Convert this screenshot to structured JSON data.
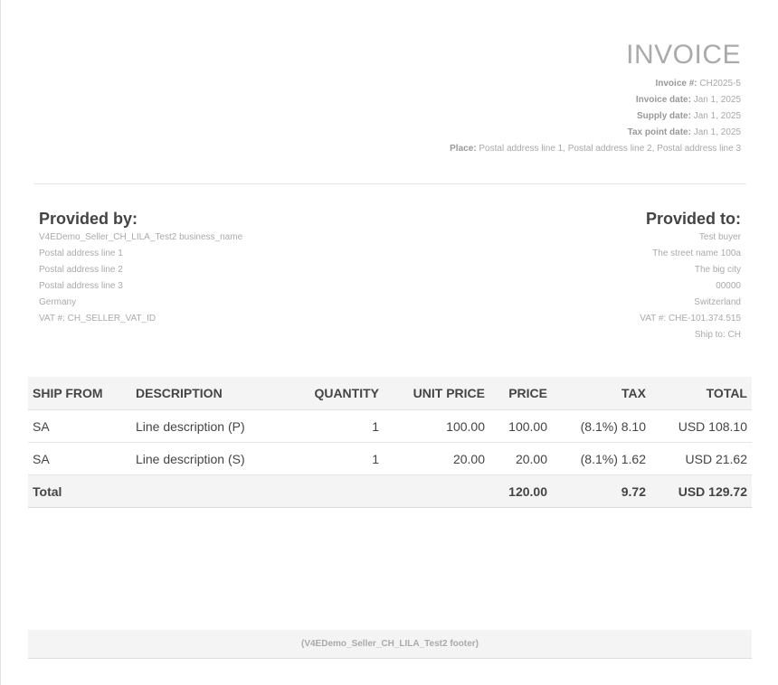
{
  "invoice": {
    "title": "INVOICE",
    "meta": [
      {
        "label": "Invoice #:",
        "value": "CH2025-5"
      },
      {
        "label": "Invoice date:",
        "value": "Jan 1, 2025"
      },
      {
        "label": "Supply date:",
        "value": "Jan 1, 2025"
      },
      {
        "label": "Tax point date:",
        "value": "Jan 1, 2025"
      },
      {
        "label": "Place:",
        "value": "Postal address line 1, Postal address line 2, Postal address line 3"
      }
    ]
  },
  "provided_by": {
    "title": "Provided by:",
    "lines": [
      "V4EDemo_Seller_CH_LILA_Test2 business_name",
      "Postal address line 1",
      "Postal address line 2",
      "Postal address line 3",
      "Germany",
      "VAT #: CH_SELLER_VAT_ID"
    ]
  },
  "provided_to": {
    "title": "Provided to:",
    "lines": [
      "Test buyer",
      "The street name 100a",
      "The big city",
      "00000",
      "Switzerland",
      "VAT #: CHE-101.374.515",
      "Ship to: CH"
    ]
  },
  "table": {
    "headers": [
      "SHIP FROM",
      "DESCRIPTION",
      "QUANTITY",
      "UNIT PRICE",
      "PRICE",
      "TAX",
      "TOTAL"
    ],
    "rows": [
      [
        "SA",
        "Line description (P)",
        "1",
        "100.00",
        "100.00",
        "(8.1%) 8.10",
        "USD 108.10"
      ],
      [
        "SA",
        "Line description (S)",
        "1",
        "20.00",
        "20.00",
        "(8.1%) 1.62",
        "USD 21.62"
      ]
    ],
    "total": {
      "label": "Total",
      "price": "120.00",
      "tax": "9.72",
      "total": "USD 129.72"
    }
  },
  "footer": {
    "text": "(V4EDemo_Seller_CH_LILA_Test2 footer)"
  }
}
